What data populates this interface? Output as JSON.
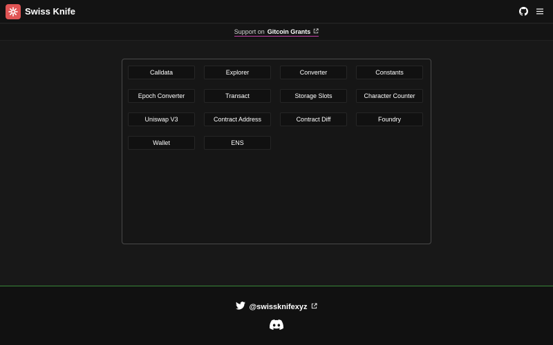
{
  "header": {
    "brand": "Swiss Knife",
    "icons": [
      "github-icon",
      "menu-icon"
    ]
  },
  "support": {
    "prefix": "Support on",
    "link_text": "Gitcoin Grants"
  },
  "tools": [
    "Calldata",
    "Explorer",
    "Converter",
    "Constants",
    "Epoch Converter",
    "Transact",
    "Storage Slots",
    "Character Counter",
    "Uniswap V3",
    "Contract Address",
    "Contract Diff",
    "Foundry",
    "Wallet",
    "ENS"
  ],
  "footer": {
    "twitter_handle": "@swissknifexyz",
    "icons": [
      "twitter-icon",
      "external-link-icon",
      "discord-icon"
    ]
  },
  "colors": {
    "background": "#181818",
    "logo": "#e05555",
    "support_underline": "#c43fa8",
    "footer_border": "#3a8a3a"
  }
}
